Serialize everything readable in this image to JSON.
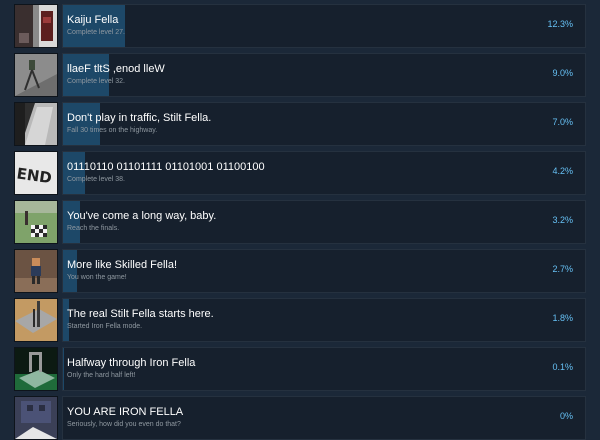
{
  "achievements": [
    {
      "name": "Kaiju Fella",
      "description": "Complete level 27.",
      "percent_label": "12.3%",
      "percent": 12.3,
      "icon": "kaiju-fella-icon"
    },
    {
      "name": "llaeF tltS ,enod lleW",
      "description": "Complete level 32.",
      "percent_label": "9.0%",
      "percent": 9.0,
      "icon": "mirrored-level-icon"
    },
    {
      "name": "Don't play in traffic, Stilt Fella.",
      "description": "Fall 30 times on the highway.",
      "percent_label": "7.0%",
      "percent": 7.0,
      "icon": "highway-icon"
    },
    {
      "name": "01110110 01101111 01101001 01100100",
      "description": "Complete level 38.",
      "percent_label": "4.2%",
      "percent": 4.2,
      "icon": "end-sign-icon"
    },
    {
      "name": "You've come a long way, baby.",
      "description": "Reach the finals.",
      "percent_label": "3.2%",
      "percent": 3.2,
      "icon": "finals-icon"
    },
    {
      "name": "More like Skilled Fella!",
      "description": "You won the game!",
      "percent_label": "2.7%",
      "percent": 2.7,
      "icon": "win-icon"
    },
    {
      "name": "The real Stilt Fella starts here.",
      "description": "Started Iron Fella mode.",
      "percent_label": "1.8%",
      "percent": 1.8,
      "icon": "iron-mode-start-icon"
    },
    {
      "name": "Halfway through Iron Fella",
      "description": "Only the hard half left!",
      "percent_label": "0.1%",
      "percent": 0.1,
      "icon": "iron-halfway-icon"
    },
    {
      "name": "YOU ARE IRON FELLA",
      "description": "Seriously, how did you even do that?",
      "percent_label": "0%",
      "percent": 0,
      "icon": "iron-fella-icon"
    }
  ]
}
